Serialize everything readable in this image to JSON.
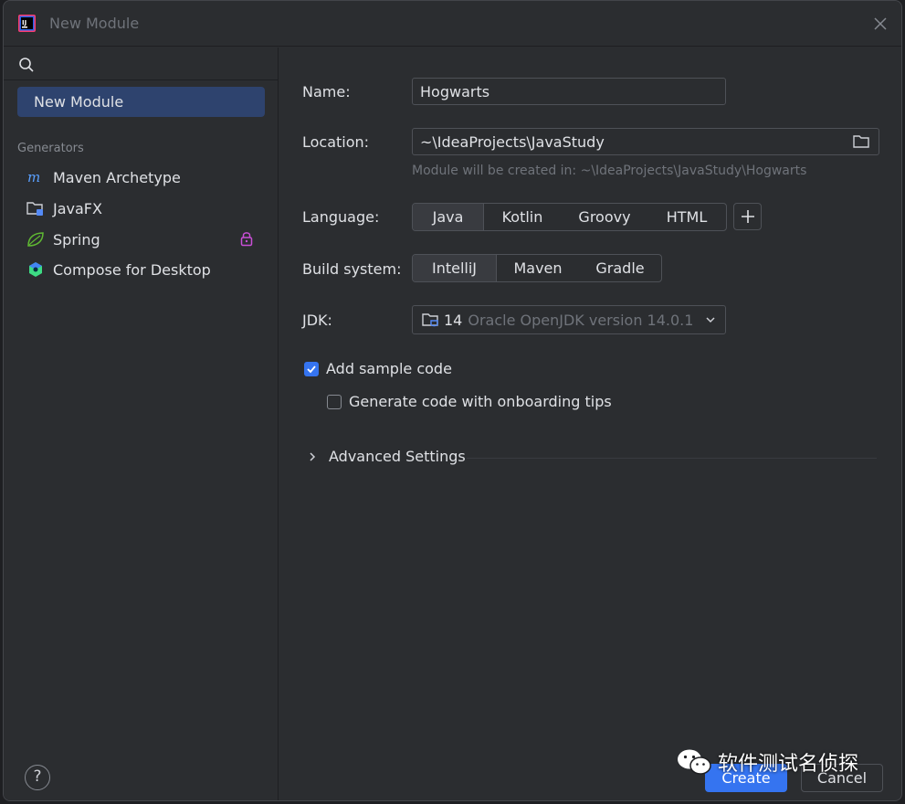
{
  "window": {
    "title": "New Module"
  },
  "sidebar": {
    "selected_label": "New Module",
    "generators_header": "Generators",
    "generators": [
      {
        "label": "Maven Archetype",
        "icon": "maven-icon"
      },
      {
        "label": "JavaFX",
        "icon": "javafx-folder-icon"
      },
      {
        "label": "Spring",
        "icon": "spring-leaf-icon",
        "locked": true
      },
      {
        "label": "Compose for Desktop",
        "icon": "compose-icon"
      }
    ],
    "help_label": "?"
  },
  "form": {
    "name_label": "Name:",
    "name_value": "Hogwarts",
    "location_label": "Location:",
    "location_value": "~\\IdeaProjects\\JavaStudy",
    "location_hint": "Module will be created in: ~\\IdeaProjects\\JavaStudy\\Hogwarts",
    "language_label": "Language:",
    "languages": [
      "Java",
      "Kotlin",
      "Groovy",
      "HTML"
    ],
    "language_selected": "Java",
    "build_label": "Build system:",
    "build_systems": [
      "IntelliJ",
      "Maven",
      "Gradle"
    ],
    "build_selected": "IntelliJ",
    "jdk_label": "JDK:",
    "jdk_version": "14",
    "jdk_desc": "Oracle OpenJDK version 14.0.1",
    "sample_code_label": "Add sample code",
    "sample_code_checked": true,
    "onboarding_label": "Generate code with onboarding tips",
    "onboarding_checked": false,
    "advanced_label": "Advanced Settings"
  },
  "buttons": {
    "create": "Create",
    "cancel": "Cancel"
  },
  "watermark": {
    "text": "软件测试名侦探"
  },
  "colors": {
    "accent": "#3574f0",
    "selected_item": "#2e436e",
    "background": "#2b2d30"
  }
}
